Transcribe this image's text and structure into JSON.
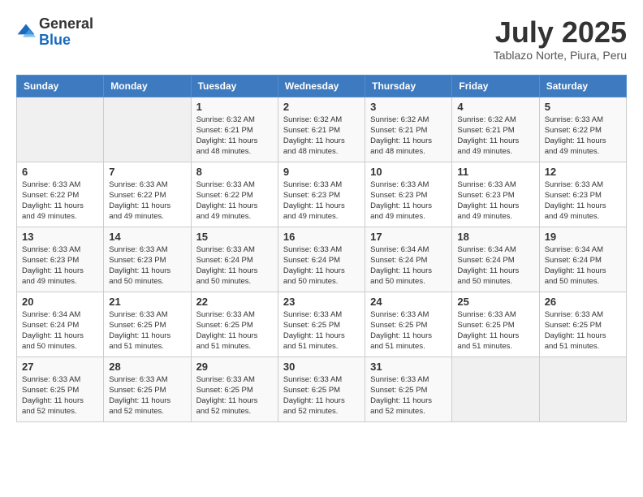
{
  "header": {
    "logo_general": "General",
    "logo_blue": "Blue",
    "month_title": "July 2025",
    "location": "Tablazo Norte, Piura, Peru"
  },
  "days_of_week": [
    "Sunday",
    "Monday",
    "Tuesday",
    "Wednesday",
    "Thursday",
    "Friday",
    "Saturday"
  ],
  "weeks": [
    [
      {
        "day": "",
        "info": ""
      },
      {
        "day": "",
        "info": ""
      },
      {
        "day": "1",
        "info": "Sunrise: 6:32 AM\nSunset: 6:21 PM\nDaylight: 11 hours\nand 48 minutes."
      },
      {
        "day": "2",
        "info": "Sunrise: 6:32 AM\nSunset: 6:21 PM\nDaylight: 11 hours\nand 48 minutes."
      },
      {
        "day": "3",
        "info": "Sunrise: 6:32 AM\nSunset: 6:21 PM\nDaylight: 11 hours\nand 48 minutes."
      },
      {
        "day": "4",
        "info": "Sunrise: 6:32 AM\nSunset: 6:21 PM\nDaylight: 11 hours\nand 49 minutes."
      },
      {
        "day": "5",
        "info": "Sunrise: 6:33 AM\nSunset: 6:22 PM\nDaylight: 11 hours\nand 49 minutes."
      }
    ],
    [
      {
        "day": "6",
        "info": "Sunrise: 6:33 AM\nSunset: 6:22 PM\nDaylight: 11 hours\nand 49 minutes."
      },
      {
        "day": "7",
        "info": "Sunrise: 6:33 AM\nSunset: 6:22 PM\nDaylight: 11 hours\nand 49 minutes."
      },
      {
        "day": "8",
        "info": "Sunrise: 6:33 AM\nSunset: 6:22 PM\nDaylight: 11 hours\nand 49 minutes."
      },
      {
        "day": "9",
        "info": "Sunrise: 6:33 AM\nSunset: 6:23 PM\nDaylight: 11 hours\nand 49 minutes."
      },
      {
        "day": "10",
        "info": "Sunrise: 6:33 AM\nSunset: 6:23 PM\nDaylight: 11 hours\nand 49 minutes."
      },
      {
        "day": "11",
        "info": "Sunrise: 6:33 AM\nSunset: 6:23 PM\nDaylight: 11 hours\nand 49 minutes."
      },
      {
        "day": "12",
        "info": "Sunrise: 6:33 AM\nSunset: 6:23 PM\nDaylight: 11 hours\nand 49 minutes."
      }
    ],
    [
      {
        "day": "13",
        "info": "Sunrise: 6:33 AM\nSunset: 6:23 PM\nDaylight: 11 hours\nand 49 minutes."
      },
      {
        "day": "14",
        "info": "Sunrise: 6:33 AM\nSunset: 6:23 PM\nDaylight: 11 hours\nand 50 minutes."
      },
      {
        "day": "15",
        "info": "Sunrise: 6:33 AM\nSunset: 6:24 PM\nDaylight: 11 hours\nand 50 minutes."
      },
      {
        "day": "16",
        "info": "Sunrise: 6:33 AM\nSunset: 6:24 PM\nDaylight: 11 hours\nand 50 minutes."
      },
      {
        "day": "17",
        "info": "Sunrise: 6:34 AM\nSunset: 6:24 PM\nDaylight: 11 hours\nand 50 minutes."
      },
      {
        "day": "18",
        "info": "Sunrise: 6:34 AM\nSunset: 6:24 PM\nDaylight: 11 hours\nand 50 minutes."
      },
      {
        "day": "19",
        "info": "Sunrise: 6:34 AM\nSunset: 6:24 PM\nDaylight: 11 hours\nand 50 minutes."
      }
    ],
    [
      {
        "day": "20",
        "info": "Sunrise: 6:34 AM\nSunset: 6:24 PM\nDaylight: 11 hours\nand 50 minutes."
      },
      {
        "day": "21",
        "info": "Sunrise: 6:33 AM\nSunset: 6:25 PM\nDaylight: 11 hours\nand 51 minutes."
      },
      {
        "day": "22",
        "info": "Sunrise: 6:33 AM\nSunset: 6:25 PM\nDaylight: 11 hours\nand 51 minutes."
      },
      {
        "day": "23",
        "info": "Sunrise: 6:33 AM\nSunset: 6:25 PM\nDaylight: 11 hours\nand 51 minutes."
      },
      {
        "day": "24",
        "info": "Sunrise: 6:33 AM\nSunset: 6:25 PM\nDaylight: 11 hours\nand 51 minutes."
      },
      {
        "day": "25",
        "info": "Sunrise: 6:33 AM\nSunset: 6:25 PM\nDaylight: 11 hours\nand 51 minutes."
      },
      {
        "day": "26",
        "info": "Sunrise: 6:33 AM\nSunset: 6:25 PM\nDaylight: 11 hours\nand 51 minutes."
      }
    ],
    [
      {
        "day": "27",
        "info": "Sunrise: 6:33 AM\nSunset: 6:25 PM\nDaylight: 11 hours\nand 52 minutes."
      },
      {
        "day": "28",
        "info": "Sunrise: 6:33 AM\nSunset: 6:25 PM\nDaylight: 11 hours\nand 52 minutes."
      },
      {
        "day": "29",
        "info": "Sunrise: 6:33 AM\nSunset: 6:25 PM\nDaylight: 11 hours\nand 52 minutes."
      },
      {
        "day": "30",
        "info": "Sunrise: 6:33 AM\nSunset: 6:25 PM\nDaylight: 11 hours\nand 52 minutes."
      },
      {
        "day": "31",
        "info": "Sunrise: 6:33 AM\nSunset: 6:25 PM\nDaylight: 11 hours\nand 52 minutes."
      },
      {
        "day": "",
        "info": ""
      },
      {
        "day": "",
        "info": ""
      }
    ]
  ]
}
